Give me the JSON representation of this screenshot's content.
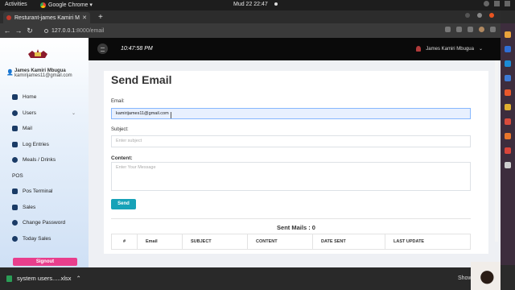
{
  "os": {
    "activities": "Activities",
    "app": "Google Chrome ▾",
    "clock": "Mud 22  22:47"
  },
  "browser": {
    "tab_title": "Resturant-james Kamiri M",
    "url_host": "127.0.0.1",
    "url_path": ":8000/email"
  },
  "sidebar": {
    "user_name": "James Kamiri Mbugua",
    "user_email": "kamirijames11@gmail.com",
    "items": [
      {
        "label": "Home",
        "icon": "home-icon"
      },
      {
        "label": "Users",
        "icon": "users-icon"
      },
      {
        "label": "Mail",
        "icon": "mail-icon"
      },
      {
        "label": "Log Entries",
        "icon": "log-icon"
      },
      {
        "label": "Meals / Drinks",
        "icon": "meals-icon"
      },
      {
        "label": "POS",
        "icon": ""
      },
      {
        "label": "Pos Terminal",
        "icon": "terminal-icon"
      },
      {
        "label": "Sales",
        "icon": "dollar-icon"
      },
      {
        "label": "Change Password",
        "icon": "key-icon"
      },
      {
        "label": "Today Sales",
        "icon": "chart-icon"
      }
    ],
    "signout": "Signout"
  },
  "header": {
    "time": "10:47:58 PM",
    "user": "James Kamiri Mbugua"
  },
  "form": {
    "title": "Send Email",
    "email_label": "Email:",
    "email_value": "kamirijames11@gmail.com",
    "subject_label": "Subject:",
    "subject_placeholder": "Enter subject",
    "content_label": "Content:",
    "content_placeholder": "Enter Your Message",
    "send_label": "Send"
  },
  "sent": {
    "title": "Sent Mails : 0",
    "columns": [
      "#",
      "Email",
      "SUBJECT",
      "CONTENT",
      "DATE SENT",
      "LAST UPDATE"
    ]
  },
  "downloads": {
    "file": "system users.....xlsx",
    "show_all": "Show"
  }
}
